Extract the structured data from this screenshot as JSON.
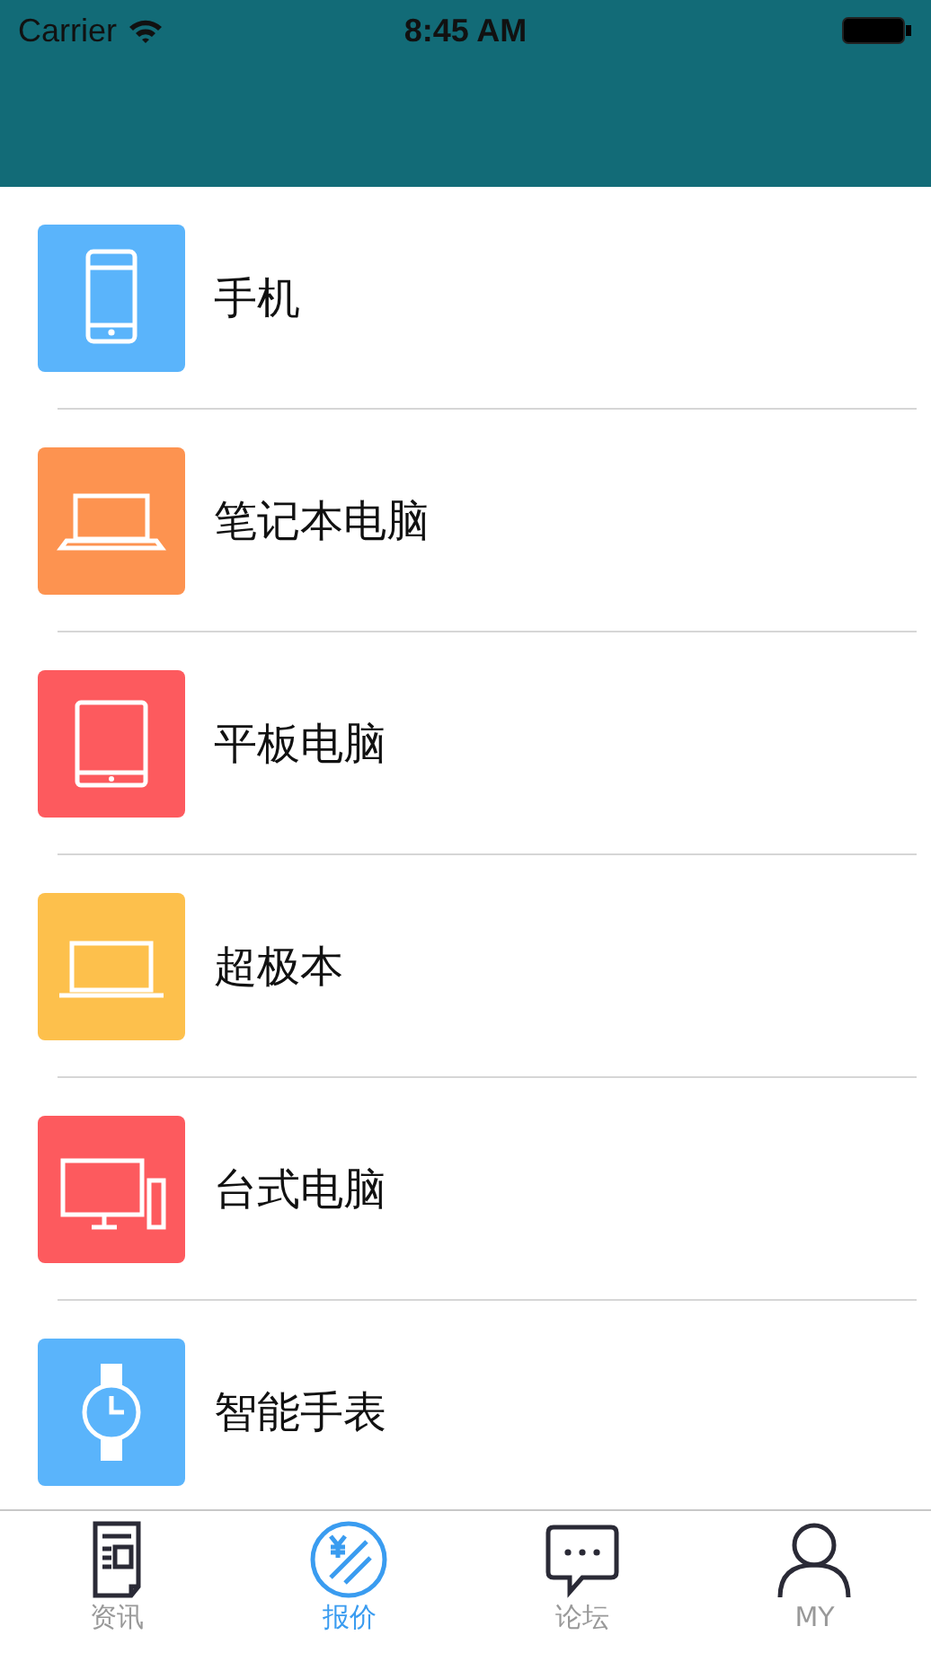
{
  "status_bar": {
    "carrier": "Carrier",
    "time": "8:45 AM"
  },
  "categories": [
    {
      "label": "手机",
      "kind": "phone",
      "color": "#5ab4fb"
    },
    {
      "label": "笔记本电脑",
      "kind": "laptop",
      "color": "#fd9350"
    },
    {
      "label": "平板电脑",
      "kind": "tablet",
      "color": "#fd5a5e"
    },
    {
      "label": "超极本",
      "kind": "ultrabook",
      "color": "#fdc04c"
    },
    {
      "label": "台式电脑",
      "kind": "desktop",
      "color": "#fd5a5e"
    },
    {
      "label": "智能手表",
      "kind": "watch",
      "color": "#5ab4fb"
    }
  ],
  "tab_bar": [
    {
      "label": "资讯",
      "kind": "news",
      "selected": false
    },
    {
      "label": "报价",
      "kind": "price",
      "selected": true
    },
    {
      "label": "论坛",
      "kind": "forum",
      "selected": false
    },
    {
      "label": "MY",
      "kind": "profile",
      "selected": false
    }
  ]
}
